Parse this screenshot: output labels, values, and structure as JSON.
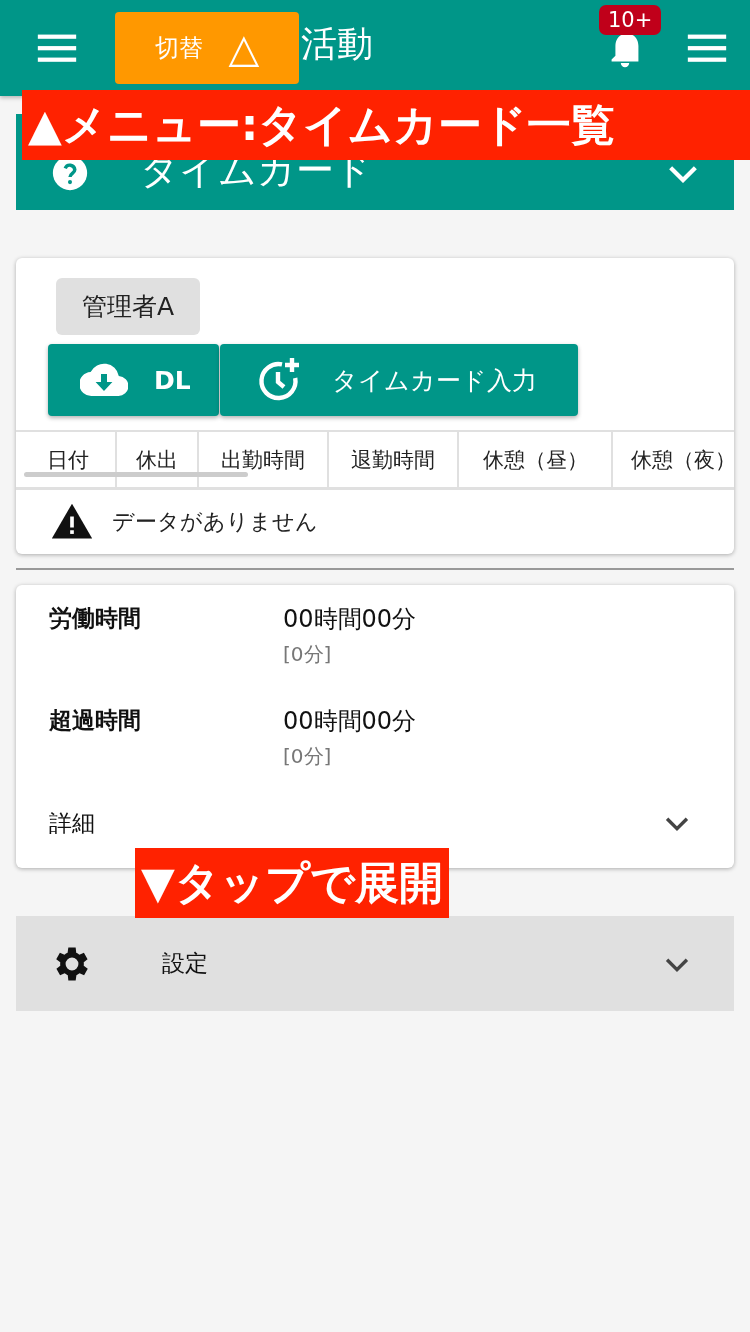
{
  "header": {
    "switch_button": {
      "label": "切替",
      "symbol": "△"
    },
    "title": "活動",
    "notification_badge": "10+"
  },
  "section_panel": {
    "title": "タイムカード",
    "expanded": false
  },
  "timecard": {
    "user_chip": "管理者A",
    "buttons": [
      {
        "kind": "download",
        "label": "DL"
      },
      {
        "kind": "clock-add",
        "label": "タイムカード入力"
      }
    ],
    "columns": [
      "日付",
      "休出",
      "出勤時間",
      "退勤時間",
      "休憩（昼）",
      "休憩（夜）"
    ],
    "empty_message": "データがありません"
  },
  "summary": {
    "rows": [
      {
        "label": "労働時間",
        "value": "00時間00分",
        "sub": "[0分]"
      },
      {
        "label": "超過時間",
        "value": "00時間00分",
        "sub": "[0分]"
      }
    ],
    "details": {
      "label": "詳細",
      "expanded": false
    }
  },
  "settings": {
    "label": "設定",
    "expanded": false
  },
  "annotations": [
    {
      "kind": "top",
      "text": "▲メニュー:タイムカード一覧"
    },
    {
      "kind": "details",
      "text": "▼タップで展開"
    }
  ]
}
